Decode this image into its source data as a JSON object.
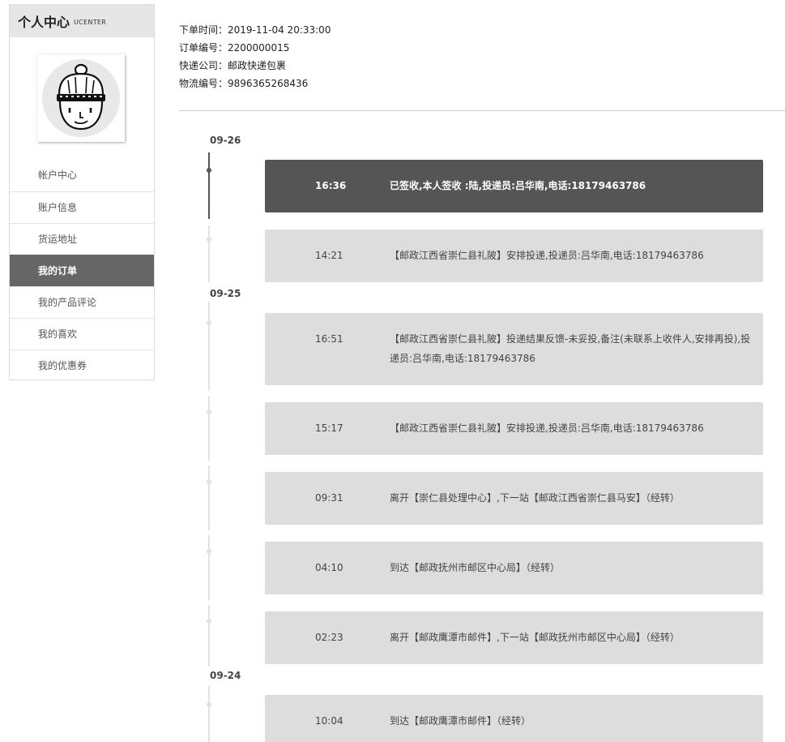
{
  "sidebar": {
    "title": "个人中心",
    "subtitle": "UCENTER",
    "avatar_icon": "beanie-face-icon",
    "items": [
      {
        "label": "帐户中心",
        "active": false
      },
      {
        "label": "账户信息",
        "active": false
      },
      {
        "label": "货运地址",
        "active": false
      },
      {
        "label": "我的订单",
        "active": true
      },
      {
        "label": "我的产品评论",
        "active": false
      },
      {
        "label": "我的喜欢",
        "active": false
      },
      {
        "label": "我的优惠券",
        "active": false
      }
    ]
  },
  "order": {
    "order_time": "下单时间：2019-11-04 20:33:00",
    "order_number": "订单编号：2200000015",
    "courier": "快递公司：邮政快递包裹",
    "tracking_number": "物流编号：9896365268436"
  },
  "timeline": {
    "dates": [
      "09-26",
      "09-25",
      "09-24"
    ],
    "events": [
      {
        "time": "16:36",
        "text": "已签收,本人签收 :陆,投递员:吕华南,电话:18179463786"
      },
      {
        "time": "14:21",
        "text": "【邮政江西省崇仁县礼陂】安排投递,投递员:吕华南,电话:18179463786"
      },
      {
        "time": "16:51",
        "text": "【邮政江西省崇仁县礼陂】投递结果反馈-未妥投,备注(未联系上收件人,安排再投),投递员:吕华南,电话:18179463786"
      },
      {
        "time": "15:17",
        "text": "【邮政江西省崇仁县礼陂】安排投递,投递员:吕华南,电话:18179463786"
      },
      {
        "time": "09:31",
        "text": "离开【崇仁县处理中心】,下一站【邮政江西省崇仁县马安】（经转）"
      },
      {
        "time": "04:10",
        "text": "到达【邮政抚州市邮区中心局】（经转）"
      },
      {
        "time": "02:23",
        "text": "离开【邮政鹰潭市邮件】,下一站【邮政抚州市邮区中心局】（经转）"
      },
      {
        "time": "10:04",
        "text": "到达【邮政鹰潭市邮件】（经转）"
      }
    ]
  },
  "colors": {
    "active_bg": "#555555",
    "card_bg": "#dddddd",
    "header_bg": "#e6e6e6"
  }
}
